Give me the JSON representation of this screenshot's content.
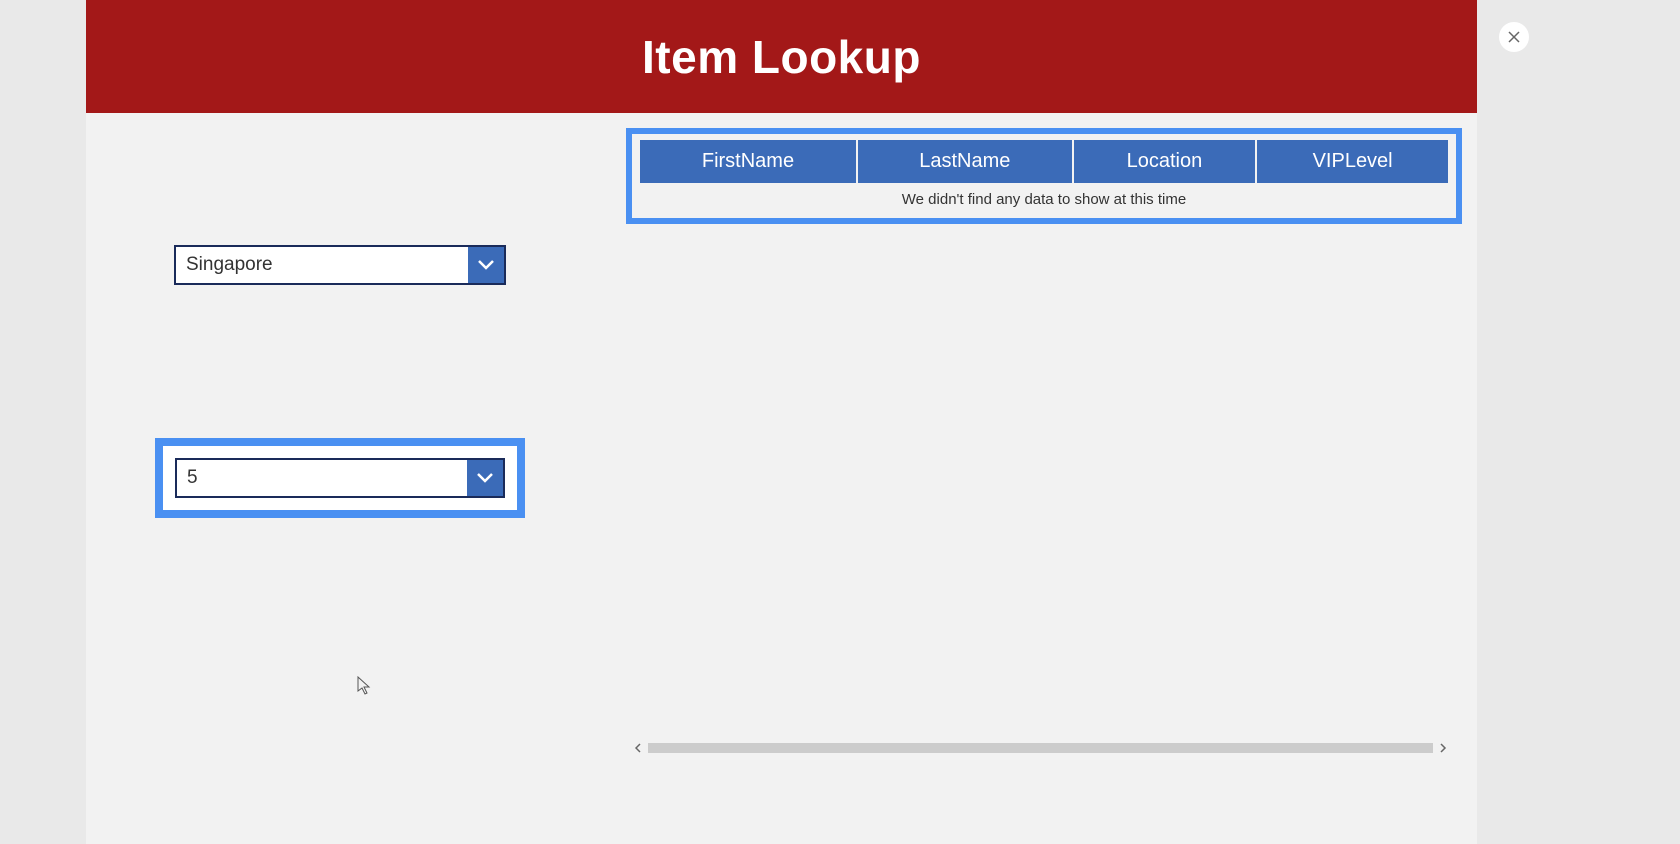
{
  "header": {
    "title": "Item Lookup"
  },
  "dropdown1": {
    "value": "Singapore"
  },
  "dropdown2": {
    "value": "5"
  },
  "table": {
    "columns": [
      "FirstName",
      "LastName",
      "Location",
      "VIPLevel"
    ],
    "empty_message": "We didn't find any data to show at this time"
  }
}
